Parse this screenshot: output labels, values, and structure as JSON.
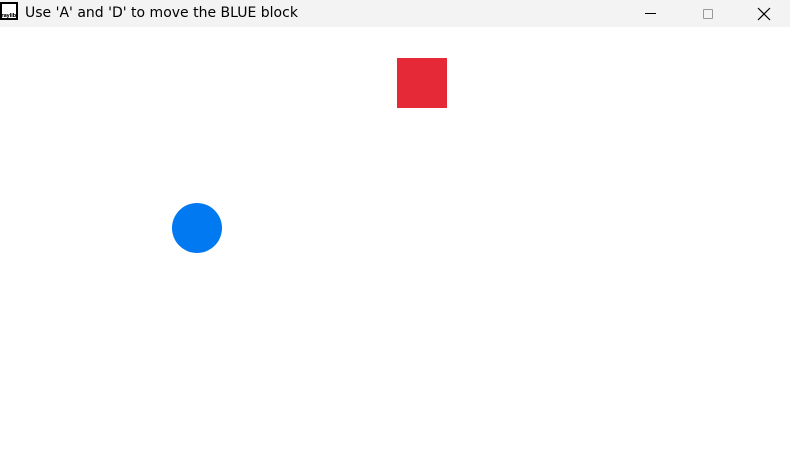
{
  "window": {
    "title": "Use 'A' and 'D' to move the BLUE block",
    "icon": "raylib-icon",
    "icon_text": "raylib",
    "controls": [
      "minimize-icon",
      "maximize-icon",
      "close-icon"
    ]
  },
  "colors": {
    "titlebar": "#f3f3f3",
    "background": "#ffffff",
    "red_block": "#e62937",
    "blue_ball": "#0079f1"
  },
  "scene": {
    "objects": [
      {
        "name": "red-block",
        "shape": "square",
        "color": "#e62937"
      },
      {
        "name": "blue-ball",
        "shape": "circle",
        "color": "#0079f1"
      }
    ]
  }
}
